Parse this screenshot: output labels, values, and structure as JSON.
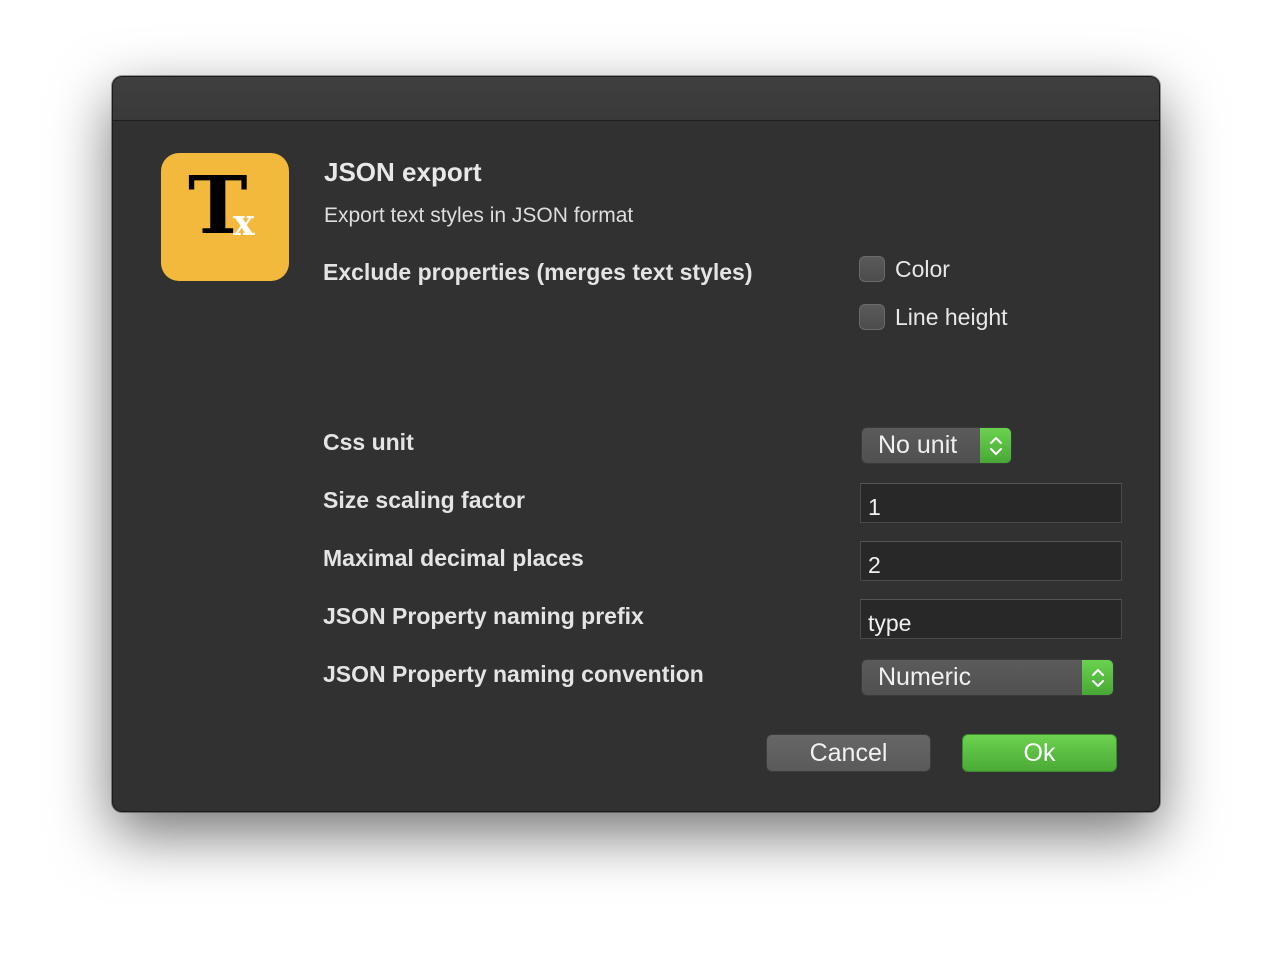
{
  "dialog": {
    "icon_letters": {
      "main": "T",
      "sub": "x"
    },
    "title": "JSON export",
    "subtitle": "Export text styles in JSON format"
  },
  "exclude": {
    "label": "Exclude properties (merges text styles)",
    "options": [
      {
        "label": "Color",
        "checked": false
      },
      {
        "label": "Line height",
        "checked": false
      }
    ]
  },
  "css_unit": {
    "label": "Css unit",
    "value": "No unit"
  },
  "size_scaling": {
    "label": "Size scaling factor",
    "value": "1"
  },
  "decimal_places": {
    "label": "Maximal decimal places",
    "value": "2"
  },
  "naming_prefix": {
    "label": "JSON Property naming prefix",
    "value": "type"
  },
  "naming_convention": {
    "label": "JSON Property naming convention",
    "value": "Numeric"
  },
  "buttons": {
    "cancel": "Cancel",
    "ok": "Ok"
  },
  "colors": {
    "icon_bg": "#f2b93c",
    "accent_green": "#5bbf43",
    "window_bg": "#313131"
  }
}
